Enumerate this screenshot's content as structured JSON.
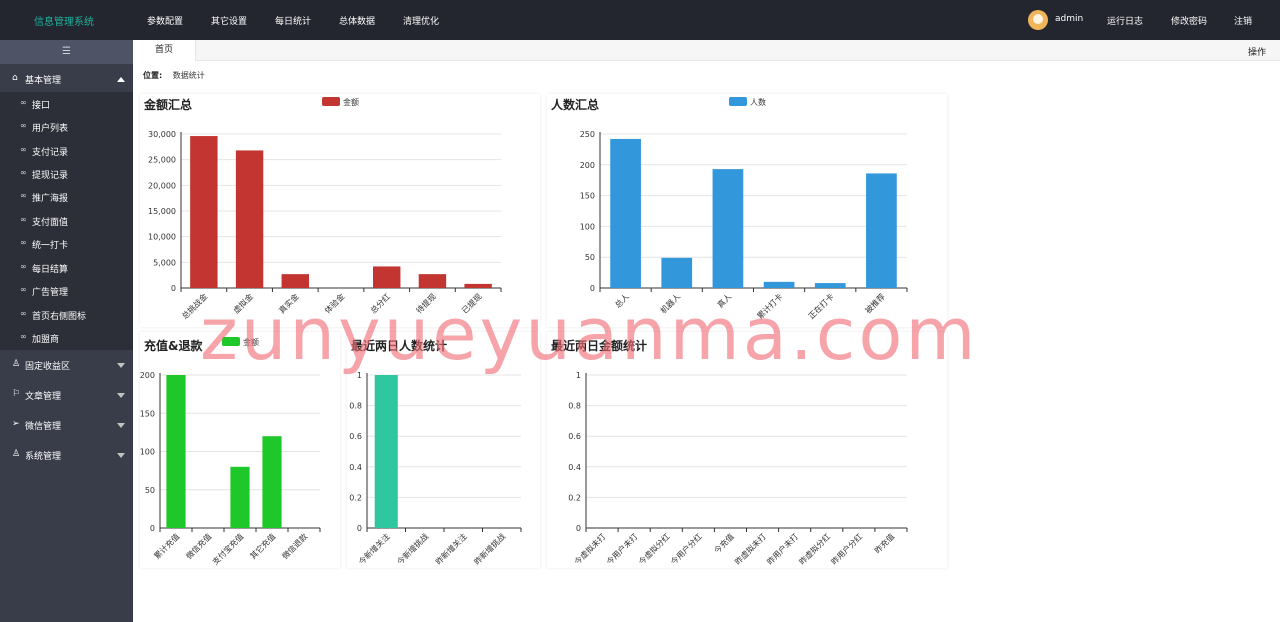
{
  "app": {
    "title": "信息管理系统"
  },
  "topnav": [
    "参数配置",
    "其它设置",
    "每日统计",
    "总体数据",
    "清理优化"
  ],
  "user": {
    "name": "admin",
    "links": [
      "运行日志",
      "修改密码",
      "注销"
    ]
  },
  "sidebar": {
    "toggle_icon": "☰",
    "sections": [
      {
        "label": "基本管理",
        "icon": "home-icon",
        "expanded": true
      },
      {
        "label": "固定收益区",
        "icon": "users-icon",
        "expanded": false
      },
      {
        "label": "文章管理",
        "icon": "flag-icon",
        "expanded": false
      },
      {
        "label": "微信管理",
        "icon": "send-icon",
        "expanded": false
      },
      {
        "label": "系统管理",
        "icon": "user-icon",
        "expanded": false
      }
    ],
    "items": [
      "接口",
      "用户列表",
      "支付记录",
      "提现记录",
      "推广海报",
      "支付面值",
      "统一打卡",
      "每日结算",
      "广告管理",
      "首页右侧图标",
      "加盟商"
    ]
  },
  "tabs": {
    "home": "首页",
    "ops": "操作"
  },
  "breadcrumb": {
    "label": "位置:",
    "value": "数据统计"
  },
  "watermark": "zunyueyuanma.com",
  "charts": {
    "amount": {
      "title": "金额汇总",
      "legend": "金额"
    },
    "people": {
      "title": "人数汇总",
      "legend": "人数"
    },
    "recharge": {
      "title": "充值&退款",
      "legend": "金额"
    },
    "recent_people": {
      "title": "最近两日人数统计"
    },
    "recent_amount": {
      "title": "最近两日金额统计"
    }
  },
  "chart_data": [
    {
      "type": "bar",
      "title": "金额汇总",
      "series": [
        {
          "name": "金额",
          "color": "#c23531",
          "values": [
            29600,
            26800,
            2700,
            0,
            4200,
            2700,
            800
          ]
        }
      ],
      "categories": [
        "总挑战金",
        "虚拟金",
        "真实金",
        "体验金",
        "总分红",
        "待提现",
        "已提现"
      ],
      "ylim": [
        0,
        30000
      ],
      "yticks": [
        0,
        5000,
        10000,
        15000,
        20000,
        25000,
        30000
      ],
      "ytick_labels": [
        "0",
        "5,000",
        "10,000",
        "15,000",
        "20,000",
        "25,000",
        "30,000"
      ],
      "legend": "top"
    },
    {
      "type": "bar",
      "title": "人数汇总",
      "series": [
        {
          "name": "人数",
          "color": "#3398db",
          "values": [
            242,
            49,
            193,
            10,
            8,
            186
          ]
        }
      ],
      "categories": [
        "总人",
        "机器人",
        "真人",
        "累计打卡",
        "正在打卡",
        "被推荐"
      ],
      "ylim": [
        0,
        250
      ],
      "yticks": [
        0,
        50,
        100,
        150,
        200,
        250
      ],
      "legend": "top"
    },
    {
      "type": "bar",
      "title": "充值&退款",
      "series": [
        {
          "name": "金额",
          "color": "#1ec72a",
          "values": [
            200,
            0,
            80,
            120,
            0
          ]
        }
      ],
      "categories": [
        "累计充值",
        "微信充值",
        "支付宝充值",
        "其它充值",
        "微信退款"
      ],
      "ylim": [
        0,
        200
      ],
      "yticks": [
        0,
        50,
        100,
        150,
        200
      ],
      "legend": "top"
    },
    {
      "type": "bar",
      "title": "最近两日人数统计",
      "series": [
        {
          "color": "#2ec7a0",
          "values": [
            1,
            0,
            0,
            0
          ]
        }
      ],
      "categories": [
        "今新增关注",
        "今新增挑战",
        "昨新增关注",
        "昨新增挑战"
      ],
      "ylim": [
        0,
        1
      ],
      "yticks": [
        0,
        0.2,
        0.4,
        0.6,
        0.8,
        1
      ]
    },
    {
      "type": "bar",
      "title": "最近两日金额统计",
      "series": [
        {
          "values": [
            0,
            0,
            0,
            0,
            0,
            0,
            0,
            0,
            0,
            0
          ]
        }
      ],
      "categories": [
        "今虚拟未打",
        "今用户未打",
        "今虚拟分红",
        "今用户分红",
        "今充值",
        "昨虚拟未打",
        "昨用户未打",
        "昨虚拟分红",
        "昨用户分红",
        "昨充值"
      ],
      "ylim": [
        0,
        1
      ],
      "yticks": [
        0,
        0.2,
        0.4,
        0.6,
        0.8,
        1
      ]
    }
  ]
}
